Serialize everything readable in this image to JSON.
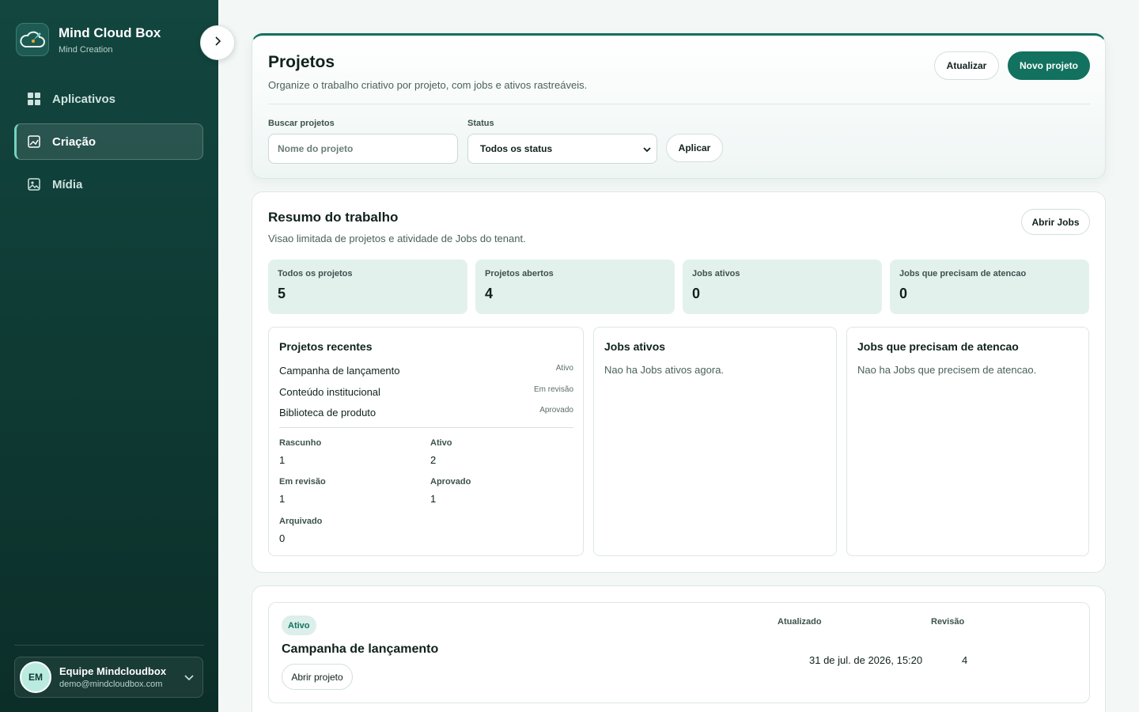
{
  "brand": {
    "title": "Mind Cloud Box",
    "subtitle": "Mind Creation"
  },
  "sidebar": {
    "items": [
      {
        "label": "Aplicativos",
        "icon": "grid-icon",
        "active": false
      },
      {
        "label": "Criação",
        "icon": "image-edit-icon",
        "active": true
      },
      {
        "label": "Mídia",
        "icon": "image-icon",
        "active": false
      }
    ]
  },
  "user": {
    "initials": "EM",
    "name": "Equipe Mindcloudbox",
    "email": "demo@mindcloudbox.com"
  },
  "header": {
    "title": "Projetos",
    "subtitle": "Organize o trabalho criativo por projeto, com jobs e ativos rastreáveis.",
    "refresh_label": "Atualizar",
    "new_label": "Novo projeto",
    "search_label": "Buscar projetos",
    "search_placeholder": "Nome do projeto",
    "status_label": "Status",
    "status_value": "Todos os status",
    "apply_label": "Aplicar"
  },
  "summary": {
    "title": "Resumo do trabalho",
    "subtitle": "Visao limitada de projetos e atividade de Jobs do tenant.",
    "open_jobs_label": "Abrir Jobs",
    "stats": [
      {
        "label": "Todos os projetos",
        "value": "5"
      },
      {
        "label": "Projetos abertos",
        "value": "4"
      },
      {
        "label": "Jobs ativos",
        "value": "0"
      },
      {
        "label": "Jobs que precisam de atencao",
        "value": "0"
      }
    ],
    "recent": {
      "title": "Projetos recentes",
      "items": [
        {
          "name": "Campanha de lançamento",
          "status": "Ativo"
        },
        {
          "name": "Conteúdo institucional",
          "status": "Em revisão"
        },
        {
          "name": "Biblioteca de produto",
          "status": "Aprovado"
        }
      ],
      "counts": [
        {
          "label": "Rascunho",
          "value": "1"
        },
        {
          "label": "Ativo",
          "value": "2"
        },
        {
          "label": "Em revisão",
          "value": "1"
        },
        {
          "label": "Aprovado",
          "value": "1"
        },
        {
          "label": "Arquivado",
          "value": "0"
        }
      ]
    },
    "active_jobs": {
      "title": "Jobs ativos",
      "empty": "Nao ha Jobs ativos agora."
    },
    "attention_jobs": {
      "title": "Jobs que precisam de atencao",
      "empty": "Nao ha Jobs que precisem de atencao."
    }
  },
  "project": {
    "status": "Ativo",
    "name": "Campanha de lançamento",
    "open_label": "Abrir projeto",
    "updated_label": "Atualizado",
    "updated_value": "31 de jul. de 2026, 15:20",
    "revision_label": "Revisão",
    "revision_value": "4"
  },
  "colors": {
    "accent": "#12715f",
    "sidebar": "#12463f",
    "stat_bg": "#e3f1ed"
  }
}
